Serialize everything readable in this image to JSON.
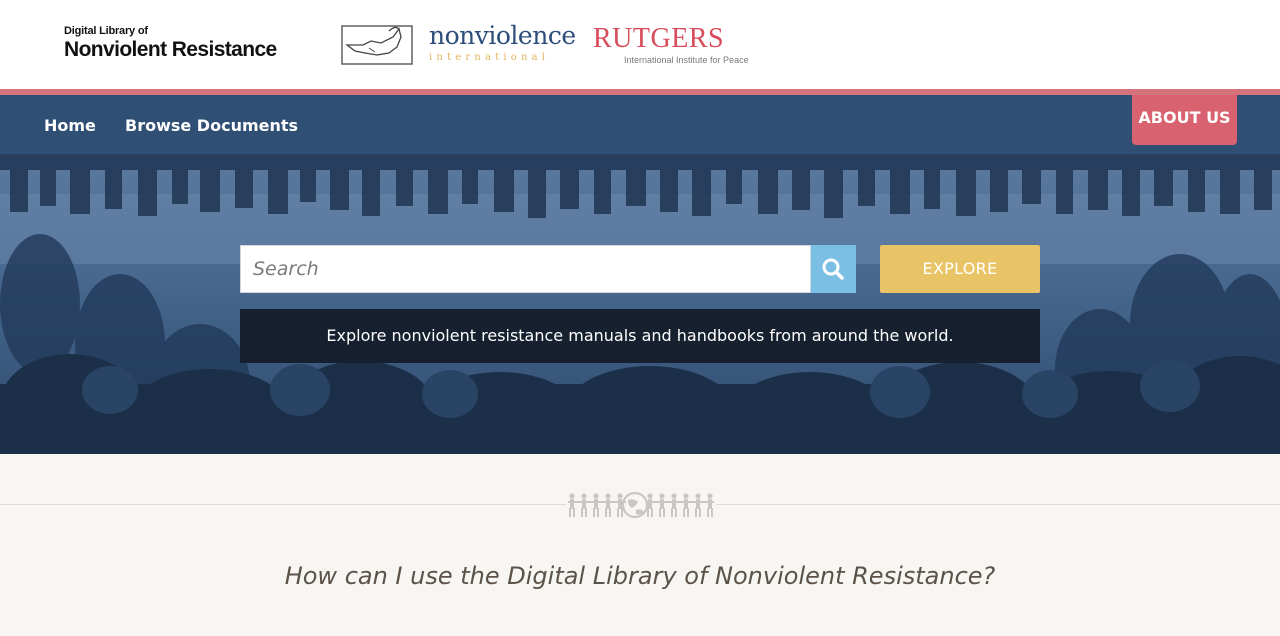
{
  "header": {
    "logo_small": "Digital Library of",
    "logo_big": "Nonviolent Resistance",
    "partner_nonviolence": "nonviolence",
    "partner_nonviolence_sub": "international",
    "partner_rutgers": "RUTGERS",
    "partner_rutgers_sub": "International Institute for Peace"
  },
  "nav": {
    "home": "Home",
    "browse": "Browse Documents",
    "about": "ABOUT US"
  },
  "hero": {
    "search_placeholder": "Search",
    "explore_label": "EXPLORE",
    "tagline": "Explore nonviolent resistance manuals and handbooks from around the world."
  },
  "main": {
    "question": "How can I use the Digital Library of Nonviolent Resistance?"
  },
  "icons": {
    "search": "search-icon",
    "dove": "dove-icon",
    "people_globe": "people-globe-icon"
  },
  "colors": {
    "nav_bg": "#2f4f75",
    "accent_red": "#d8626f",
    "explore_yellow": "#e9c467",
    "search_blue": "#7cbfe4",
    "tagline_bg": "#16202e"
  }
}
